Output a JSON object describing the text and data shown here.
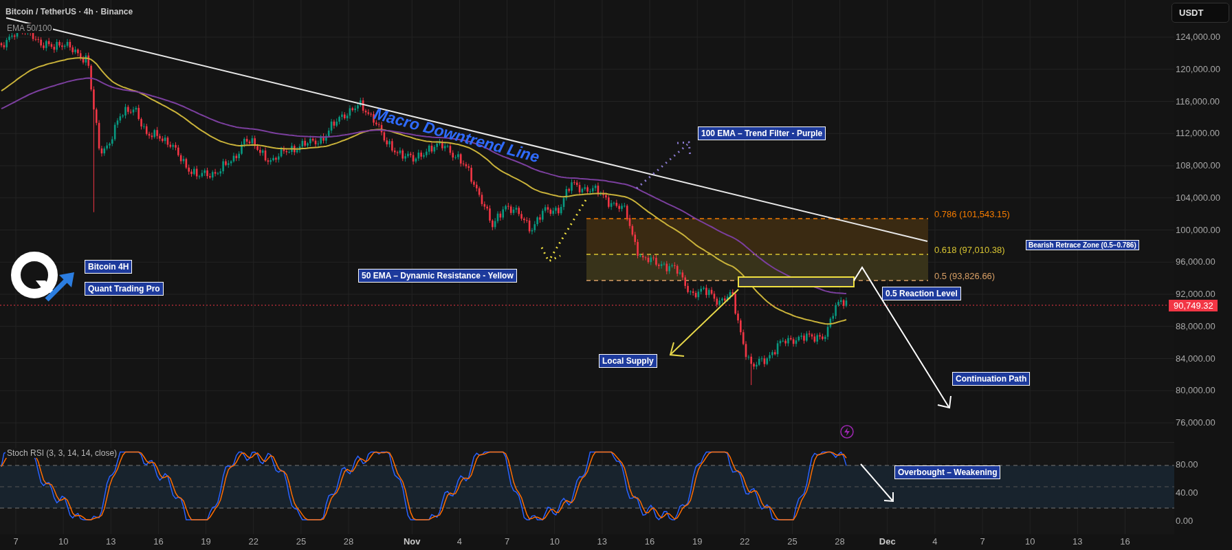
{
  "header": {
    "title": "Bitcoin / TetherUS · 4h · Binance",
    "indicator": "EMA 50/100"
  },
  "currency_button": "USDT",
  "price_axis": {
    "labels": [
      "124,000.00",
      "120,000.00",
      "116,000.00",
      "112,000.00",
      "108,000.00",
      "104,000.00",
      "100,000.00",
      "96,000.00",
      "92,000.00",
      "88,000.00",
      "84,000.00",
      "80,000.00",
      "76,000.00"
    ],
    "current_price": "90,749.32"
  },
  "brand": {
    "title": "Bitcoin 4H",
    "subtitle": "Quant Trading Pro"
  },
  "trendline_label": "Macro Downtrend Line",
  "callouts": {
    "ema100": "100 EMA – Trend Filter - Purple",
    "ema50": "50 EMA – Dynamic Resistance - Yellow",
    "local_supply": "Local Supply",
    "reaction_level": "0.5 Reaction Level",
    "continuation": "Continuation Path",
    "retrace_zone": "Bearish Retrace Zone (0.5–0.786)"
  },
  "fib_levels": [
    {
      "label": "0.786 (101,543.15)",
      "color": "#f57c00"
    },
    {
      "label": "0.618 (97,010.38)",
      "color": "#d9c532"
    },
    {
      "label": "0.5 (93,826.66)",
      "color": "#d9a066"
    }
  ],
  "stoch_rsi": {
    "title": "Stoch RSI (3, 3, 14, 14, close)",
    "callout": "Overbought – Weakening",
    "axis_labels": [
      "80.00",
      "40.00",
      "0.00"
    ]
  },
  "time_axis": [
    {
      "label": "7",
      "month": false
    },
    {
      "label": "10",
      "month": false
    },
    {
      "label": "13",
      "month": false
    },
    {
      "label": "16",
      "month": false
    },
    {
      "label": "19",
      "month": false
    },
    {
      "label": "22",
      "month": false
    },
    {
      "label": "25",
      "month": false
    },
    {
      "label": "28",
      "month": false
    },
    {
      "label": "Nov",
      "month": true
    },
    {
      "label": "4",
      "month": false
    },
    {
      "label": "7",
      "month": false
    },
    {
      "label": "10",
      "month": false
    },
    {
      "label": "13",
      "month": false
    },
    {
      "label": "16",
      "month": false
    },
    {
      "label": "19",
      "month": false
    },
    {
      "label": "22",
      "month": false
    },
    {
      "label": "25",
      "month": false
    },
    {
      "label": "28",
      "month": false
    },
    {
      "label": "Dec",
      "month": true
    },
    {
      "label": "4",
      "month": false
    },
    {
      "label": "7",
      "month": false
    },
    {
      "label": "10",
      "month": false
    },
    {
      "label": "13",
      "month": false
    },
    {
      "label": "16",
      "month": false
    }
  ]
}
